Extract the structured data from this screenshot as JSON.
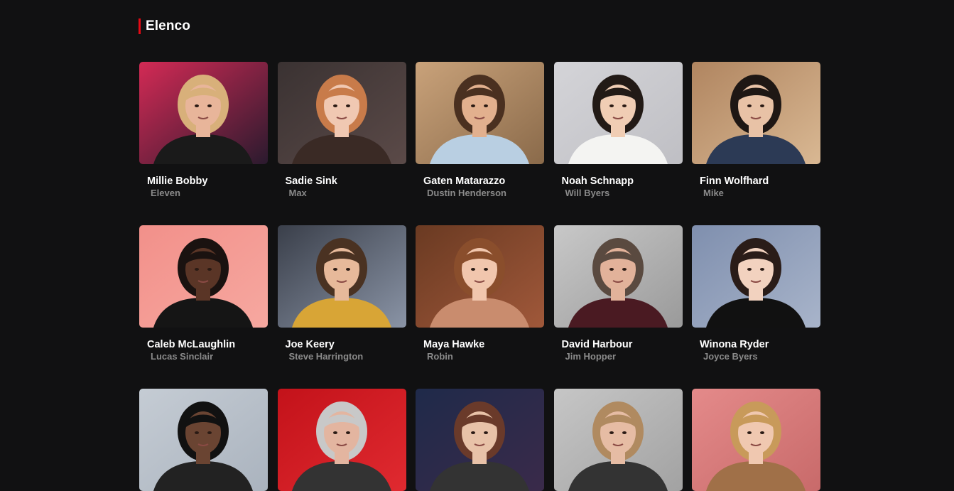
{
  "section": {
    "title": "Elenco",
    "accent_color": "#e50914"
  },
  "cast": [
    {
      "actor": "Millie Bobby",
      "character": "Eleven",
      "bg": "#d42a55",
      "bg2": "#2a1a2e",
      "skin": "#e8b59a",
      "hair": "#d8b07a",
      "cloth": "#1a1a1a"
    },
    {
      "actor": "Sadie Sink",
      "character": "Max",
      "bg": "#3a3232",
      "bg2": "#5b4a48",
      "skin": "#f0c8b2",
      "hair": "#c87b4a",
      "cloth": "#3a2a25"
    },
    {
      "actor": "Gaten Matarazzo",
      "character": "Dustin Henderson",
      "bg": "#c9a27a",
      "bg2": "#8a6a4a",
      "skin": "#e2b08e",
      "hair": "#4a3020",
      "cloth": "#b9cfe2"
    },
    {
      "actor": "Noah Schnapp",
      "character": "Will Byers",
      "bg": "#d4d4d8",
      "bg2": "#bfbfc4",
      "skin": "#f0cdb4",
      "hair": "#221a16",
      "cloth": "#f4f4f2"
    },
    {
      "actor": "Finn Wolfhard",
      "character": "Mike",
      "bg": "#b08560",
      "bg2": "#d9b893",
      "skin": "#e8c2a6",
      "hair": "#1e1714",
      "cloth": "#2c3a55"
    },
    {
      "actor": "Caleb McLaughlin",
      "character": "Lucas Sinclair",
      "bg": "#f2908a",
      "bg2": "#f6a8a0",
      "skin": "#5a3526",
      "hair": "#1a1210",
      "cloth": "#151515"
    },
    {
      "actor": "Joe Keery",
      "character": "Steve Harrington",
      "bg": "#3a3f4a",
      "bg2": "#8a94a6",
      "skin": "#e7b99a",
      "hair": "#4a3222",
      "cloth": "#d8a536"
    },
    {
      "actor": "Maya Hawke",
      "character": "Robin",
      "bg": "#6a3a22",
      "bg2": "#a0583a",
      "skin": "#f1c6ad",
      "hair": "#8a4e2c",
      "cloth": "#c98c6e"
    },
    {
      "actor": "David Harbour",
      "character": "Jim Hopper",
      "bg": "#c8c8c8",
      "bg2": "#9a9a9a",
      "skin": "#e2b29a",
      "hair": "#5a4a40",
      "cloth": "#4a1a22"
    },
    {
      "actor": "Winona Ryder",
      "character": "Joyce Byers",
      "bg": "#7f8fae",
      "bg2": "#a8b4ca",
      "skin": "#f2d2bf",
      "hair": "#2a1c18",
      "cloth": "#111111"
    },
    {
      "actor": "",
      "character": "",
      "bg": "#c5ccd4",
      "bg2": "#aab3be",
      "skin": "#6a4432",
      "hair": "#111111",
      "cloth": "#222222"
    },
    {
      "actor": "",
      "character": "",
      "bg": "#c3121a",
      "bg2": "#e02a30",
      "skin": "#e3b5a0",
      "hair": "#c8c8c8",
      "cloth": "#333333"
    },
    {
      "actor": "",
      "character": "",
      "bg": "#1f2a4a",
      "bg2": "#3a2a4a",
      "skin": "#e8c2a8",
      "hair": "#6a3a2a",
      "cloth": "#333333"
    },
    {
      "actor": "",
      "character": "",
      "bg": "#c6c6c6",
      "bg2": "#a2a2a2",
      "skin": "#e6bca4",
      "hair": "#b08a60",
      "cloth": "#333333"
    },
    {
      "actor": "",
      "character": "",
      "bg": "#e48a8a",
      "bg2": "#c86a6a",
      "skin": "#f0c8b0",
      "hair": "#c89a5a",
      "cloth": "#a07048"
    }
  ]
}
